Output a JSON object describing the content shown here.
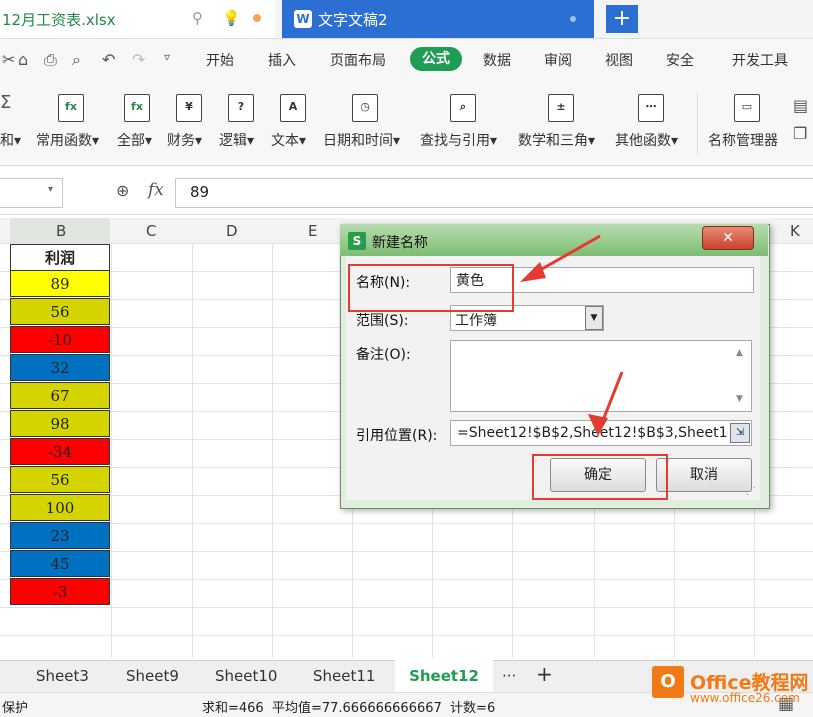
{
  "tabs": {
    "file_name": "12月工资表.xlsx",
    "doc_icon": "W",
    "doc_name": "文字文稿2",
    "add": "+"
  },
  "menu": [
    "开始",
    "插入",
    "页面布局",
    "公式",
    "数据",
    "审阅",
    "视图",
    "安全",
    "开发工具"
  ],
  "ribbon_tools": [
    {
      "label": "和▾",
      "icon": "sum-icon"
    },
    {
      "label": "常用函数▾",
      "icon": "fx-star-icon"
    },
    {
      "label": "全部▾",
      "icon": "fx-icon"
    },
    {
      "label": "财务▾",
      "icon": "yen-book-icon"
    },
    {
      "label": "逻辑▾",
      "icon": "question-book-icon"
    },
    {
      "label": "文本▾",
      "icon": "text-book-icon"
    },
    {
      "label": "日期和时间▾",
      "icon": "clock-book-icon"
    },
    {
      "label": "查找与引用▾",
      "icon": "search-book-icon"
    },
    {
      "label": "数学和三角▾",
      "icon": "math-book-icon"
    },
    {
      "label": "其他函数▾",
      "icon": "more-book-icon"
    },
    {
      "label": "名称管理器",
      "icon": "name-manager-icon"
    }
  ],
  "formula_bar": {
    "fx": "fx",
    "value": "89"
  },
  "columns": [
    "B",
    "C",
    "D",
    "E",
    "K"
  ],
  "column_b": {
    "title": "利润",
    "cells": [
      {
        "value": "89",
        "color": "#ffff00"
      },
      {
        "value": "56",
        "color": "#d4d400"
      },
      {
        "value": "-10",
        "color": "#ff0000"
      },
      {
        "value": "32",
        "color": "#0070c0"
      },
      {
        "value": "67",
        "color": "#d4d400"
      },
      {
        "value": "98",
        "color": "#d4d400"
      },
      {
        "value": "-34",
        "color": "#ff0000"
      },
      {
        "value": "56",
        "color": "#d4d400"
      },
      {
        "value": "100",
        "color": "#d4d400"
      },
      {
        "value": "23",
        "color": "#0070c0"
      },
      {
        "value": "45",
        "color": "#0070c0"
      },
      {
        "value": "-3",
        "color": "#ff0000"
      }
    ]
  },
  "dialog": {
    "title": "新建名称",
    "s_icon": "S",
    "close": "✕",
    "name_label": "名称(N):",
    "name_value": "黄色",
    "scope_label": "范围(S):",
    "scope_value": "工作簿",
    "note_label": "备注(O):",
    "ref_label": "引用位置(R):",
    "ref_value": "=Sheet12!$B$2,Sheet12!$B$3,Sheet1",
    "ok": "确定",
    "cancel": "取消"
  },
  "sheets": [
    "Sheet3",
    "Sheet9",
    "Sheet10",
    "Sheet11",
    "Sheet12"
  ],
  "sheet_more": "···",
  "sheet_add": "+",
  "status": {
    "protect": "保护",
    "summary": "求和=466  平均值=77.666666666667  计数=6"
  },
  "watermark": {
    "logo": "O",
    "brand": "Office教程网",
    "url": "www.office26.com"
  }
}
